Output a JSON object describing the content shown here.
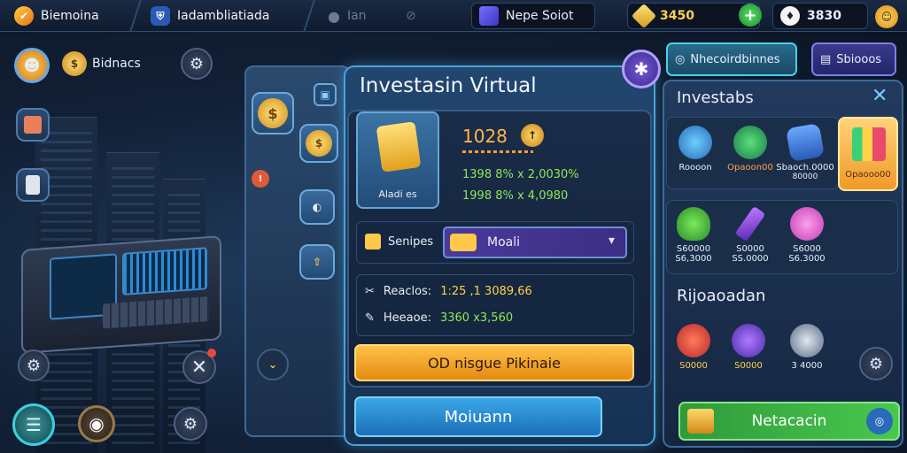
{
  "topbar": {
    "tab1": "Biemoina",
    "tab2": "Iadambliatiada",
    "tab3": "Ian",
    "tab4": "Nepe Soiot",
    "currency_gold": "3450",
    "currency_diamond": "3830"
  },
  "left": {
    "profile_label": "Bidnacs"
  },
  "panel": {
    "title": "Investasin Virtual",
    "card_label": "Aladi es",
    "price": "1028",
    "stat1": "1398 8% x 2,0030%",
    "stat2": "1998 8% x 4,0980",
    "select_label": "Senipes",
    "select_value": "Moali",
    "row1_label": "Reaclos:",
    "row1_value": "1:25 ,1 3089,66",
    "row2_label": "Heeaoe:",
    "row2_value": "3360 x3,560",
    "orange_button": "OD nisgue Pikinaie",
    "blue_button": "Moiuann"
  },
  "right": {
    "tab1": "Nhecoirdbinnes",
    "tab2": "Sbiooos",
    "section1": "Investabs",
    "items_row1": [
      "Roooon",
      "Opaoon00",
      "Sbaoch.0000",
      "Opaooo00"
    ],
    "items_row1_sub": [
      "",
      "",
      "80000",
      ""
    ],
    "items_row2": [
      "S60000",
      "S0000",
      "S6000"
    ],
    "items_row2_sub": [
      "S6,3000",
      "SS.0000",
      "S6.3000"
    ],
    "section2": "Rijoaoadan",
    "items_row3": [
      "S0000",
      "S0000",
      "3 4000"
    ],
    "green_button": "Netacacin"
  },
  "colors": {
    "accent_blue": "#4aa4d8",
    "accent_orange": "#f2a32c",
    "accent_green": "#49c84e",
    "gold": "#ffd04c"
  }
}
